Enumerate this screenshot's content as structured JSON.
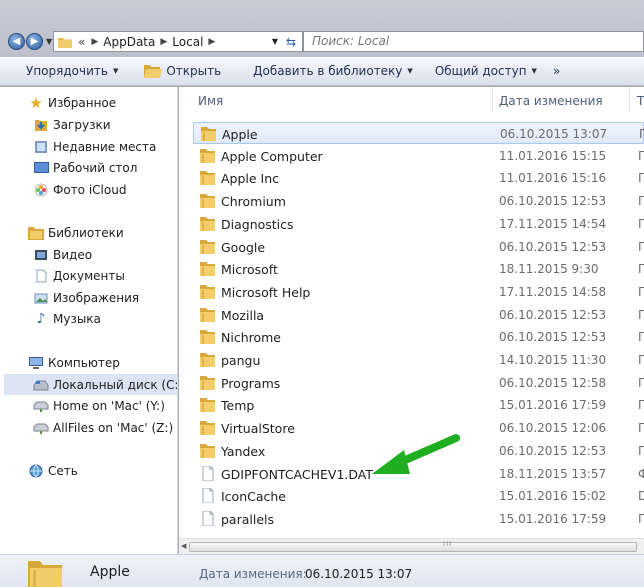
{
  "address": {
    "crumbs": [
      "«",
      "AppData",
      "Local"
    ],
    "search_placeholder": "Поиск: Local"
  },
  "toolbar": {
    "organize": "Упорядочить",
    "open": "Открыть",
    "add_library": "Добавить в библиотеку",
    "share": "Общий доступ",
    "more": "»"
  },
  "nav": {
    "favorites": "Избранное",
    "fav_items": [
      "Загрузки",
      "Недавние места",
      "Рабочий стол",
      "Фото iCloud"
    ],
    "libraries": "Библиотеки",
    "lib_items": [
      "Видео",
      "Документы",
      "Изображения",
      "Музыка"
    ],
    "computer": "Компьютер",
    "comp_items": [
      "Локальный диск (C:)",
      "Home on 'Mac' (Y:)",
      "AllFiles on 'Mac' (Z:)"
    ],
    "network": "Сеть"
  },
  "columns": {
    "name": "Имя",
    "date": "Дата изменения",
    "type": "Т"
  },
  "files": [
    {
      "name": "Apple",
      "date": "06.10.2015 13:07",
      "type": "П",
      "kind": "folder"
    },
    {
      "name": "Apple Computer",
      "date": "11.01.2016 15:15",
      "type": "П",
      "kind": "folder"
    },
    {
      "name": "Apple Inc",
      "date": "11.01.2016 15:16",
      "type": "П",
      "kind": "folder"
    },
    {
      "name": "Chromium",
      "date": "06.10.2015 12:53",
      "type": "П",
      "kind": "folder"
    },
    {
      "name": "Diagnostics",
      "date": "17.11.2015 14:54",
      "type": "П",
      "kind": "folder"
    },
    {
      "name": "Google",
      "date": "06.10.2015 12:53",
      "type": "П",
      "kind": "folder"
    },
    {
      "name": "Microsoft",
      "date": "18.11.2015 9:30",
      "type": "П",
      "kind": "folder"
    },
    {
      "name": "Microsoft Help",
      "date": "17.11.2015 14:58",
      "type": "П",
      "kind": "folder"
    },
    {
      "name": "Mozilla",
      "date": "06.10.2015 12:53",
      "type": "П",
      "kind": "folder"
    },
    {
      "name": "Nichrome",
      "date": "06.10.2015 12:53",
      "type": "П",
      "kind": "folder"
    },
    {
      "name": "pangu",
      "date": "14.10.2015 11:30",
      "type": "П",
      "kind": "folder"
    },
    {
      "name": "Programs",
      "date": "06.10.2015 12:58",
      "type": "П",
      "kind": "folder"
    },
    {
      "name": "Temp",
      "date": "15.01.2016 17:59",
      "type": "П",
      "kind": "folder"
    },
    {
      "name": "VirtualStore",
      "date": "06.10.2015 12:06",
      "type": "П",
      "kind": "folder"
    },
    {
      "name": "Yandex",
      "date": "06.10.2015 12:53",
      "type": "П",
      "kind": "folder"
    },
    {
      "name": "GDIPFONTCACHEV1.DAT",
      "date": "18.11.2015 13:57",
      "type": "Ф",
      "kind": "file"
    },
    {
      "name": "IconCache",
      "date": "15.01.2016 15:02",
      "type": "D",
      "kind": "file"
    },
    {
      "name": "parallels",
      "date": "15.01.2016 17:59",
      "type": "П",
      "kind": "file"
    }
  ],
  "details": {
    "name": "Apple",
    "label": "Дата изменения:",
    "value": "06.10.2015 13:07"
  },
  "colors": {
    "arrow": "#1fae1f",
    "folder": "#e8b84a",
    "selection": "#dfeafa"
  }
}
